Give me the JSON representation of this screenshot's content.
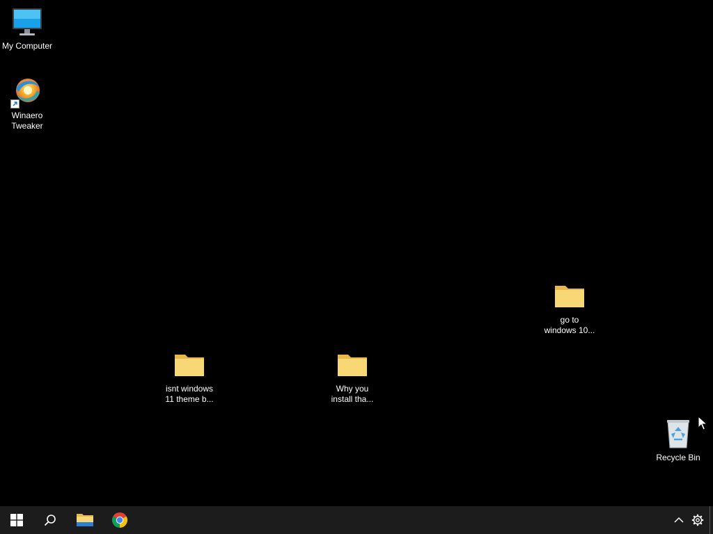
{
  "desktop": {
    "icons": [
      {
        "label": "My Computer",
        "icon": "monitor-icon"
      },
      {
        "label": "Winaero\nTweaker",
        "icon": "winaero-tweaker-icon",
        "shortcut": true
      },
      {
        "label": "go to\nwindows 10...",
        "icon": "folder-icon"
      },
      {
        "label": "isnt windows\n11 theme b...",
        "icon": "folder-icon"
      },
      {
        "label": "Why you\ninstall tha...",
        "icon": "folder-icon"
      },
      {
        "label": "Recycle Bin",
        "icon": "recycle-bin-icon"
      }
    ]
  },
  "taskbar": {
    "buttons": [
      "start-icon",
      "search-icon",
      "file-explorer-icon",
      "chrome-icon"
    ],
    "tray": [
      "chevron-up-icon",
      "gear-icon"
    ]
  },
  "colors": {
    "desktop_bg": "#000000",
    "taskbar_bg": "#1c1c1c",
    "folder": "#f8d775",
    "folder_dark": "#e8b84a",
    "active_indicator": "#76b9ed"
  }
}
